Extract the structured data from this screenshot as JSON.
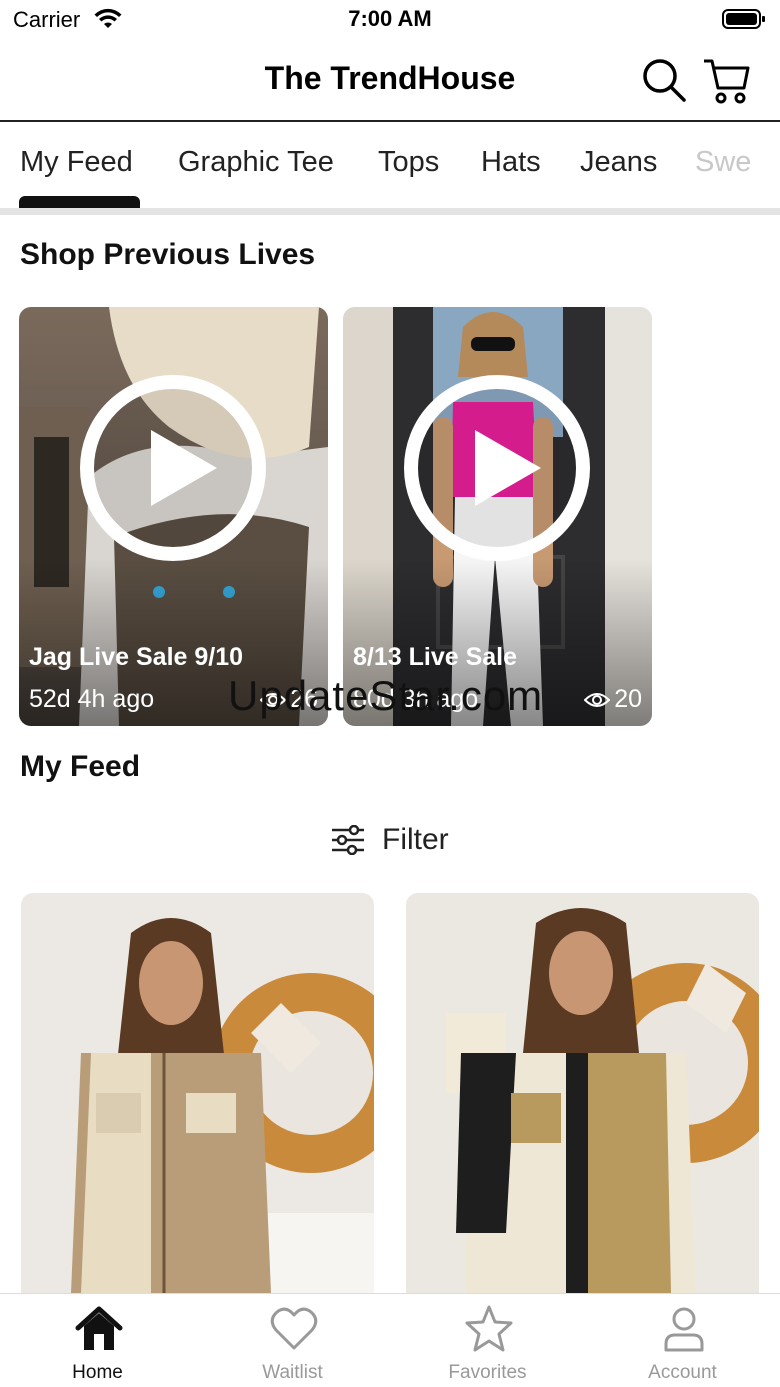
{
  "status_bar": {
    "carrier": "Carrier",
    "time": "7:00 AM"
  },
  "header": {
    "title": "The TrendHouse",
    "search_icon": "search-icon",
    "cart_icon": "cart-icon"
  },
  "tabs": [
    {
      "label": "My Feed",
      "active": true
    },
    {
      "label": "Graphic Tee"
    },
    {
      "label": "Tops"
    },
    {
      "label": "Hats"
    },
    {
      "label": "Jeans"
    },
    {
      "label": "Swe"
    }
  ],
  "sections": {
    "previous_lives": "Shop Previous Lives",
    "my_feed": "My Feed"
  },
  "lives": [
    {
      "title": "Jag Live Sale 9/10",
      "ago": "52d 4h ago",
      "views": "26"
    },
    {
      "title": "8/13 Live Sale",
      "ago": "80d 3h ago",
      "views": "20"
    }
  ],
  "watermark": "UpdateStar.com",
  "filter": {
    "label": "Filter",
    "icon": "sliders-icon"
  },
  "bottom_nav": [
    {
      "label": "Home",
      "icon": "home-icon",
      "active": true
    },
    {
      "label": "Waitlist",
      "icon": "heart-icon"
    },
    {
      "label": "Favorites",
      "icon": "star-icon"
    },
    {
      "label": "Account",
      "icon": "user-icon"
    }
  ],
  "colors": {
    "accent": "#111111",
    "inactive": "#999999",
    "top1": "#e81f9a"
  }
}
